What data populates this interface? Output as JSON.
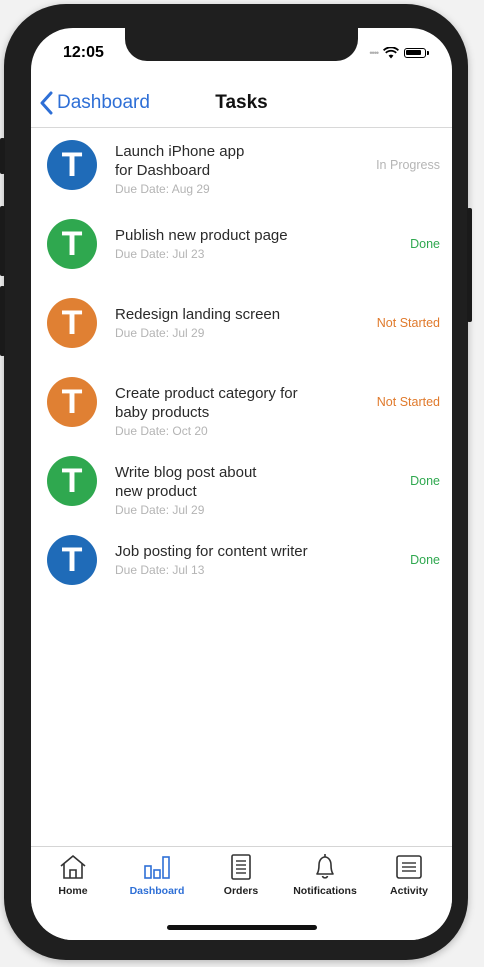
{
  "status_bar": {
    "time": "12:05",
    "signal": "••••"
  },
  "navbar": {
    "back_label": "Dashboard",
    "title": "Tasks"
  },
  "tasks": [
    {
      "initial": "T",
      "title_line1": "Launch iPhone app",
      "title_line2": "for Dashboard",
      "due": "Due Date: Aug 29",
      "status": "In Progress",
      "avatar_color": "#1f6bb8",
      "status_color": "#b5b5b5"
    },
    {
      "initial": "T",
      "title_line1": "Publish new product page",
      "title_line2": "",
      "due": "Due Date: Jul 23",
      "status": "Done",
      "avatar_color": "#2fa84f",
      "status_color": "#2fa84f"
    },
    {
      "initial": "T",
      "title_line1": "Redesign landing screen",
      "title_line2": "",
      "due": "Due Date: Jul 29",
      "status": "Not Started",
      "avatar_color": "#e08033",
      "status_color": "#e07a2c"
    },
    {
      "initial": "T",
      "title_line1": "Create product category for",
      "title_line2": "baby products",
      "due": "Due Date: Oct 20",
      "status": "Not Started",
      "avatar_color": "#e08033",
      "status_color": "#e07a2c"
    },
    {
      "initial": "T",
      "title_line1": "Write blog post about",
      "title_line2": "new product",
      "due": "Due Date: Jul 29",
      "status": "Done",
      "avatar_color": "#2fa84f",
      "status_color": "#2fa84f"
    },
    {
      "initial": "T",
      "title_line1": "Job posting for content writer",
      "title_line2": "",
      "due": "Due Date: Jul 13",
      "status": "Done",
      "avatar_color": "#1f6bb8",
      "status_color": "#2fa84f"
    }
  ],
  "tabbar": {
    "active": "Dashboard",
    "accent_color": "#2e6fd6",
    "tabs": [
      {
        "label": "Home",
        "icon": "home-icon"
      },
      {
        "label": "Dashboard",
        "icon": "bar-chart-icon"
      },
      {
        "label": "Orders",
        "icon": "document-icon"
      },
      {
        "label": "Notifications",
        "icon": "bell-icon"
      },
      {
        "label": "Activity",
        "icon": "list-icon"
      }
    ]
  }
}
